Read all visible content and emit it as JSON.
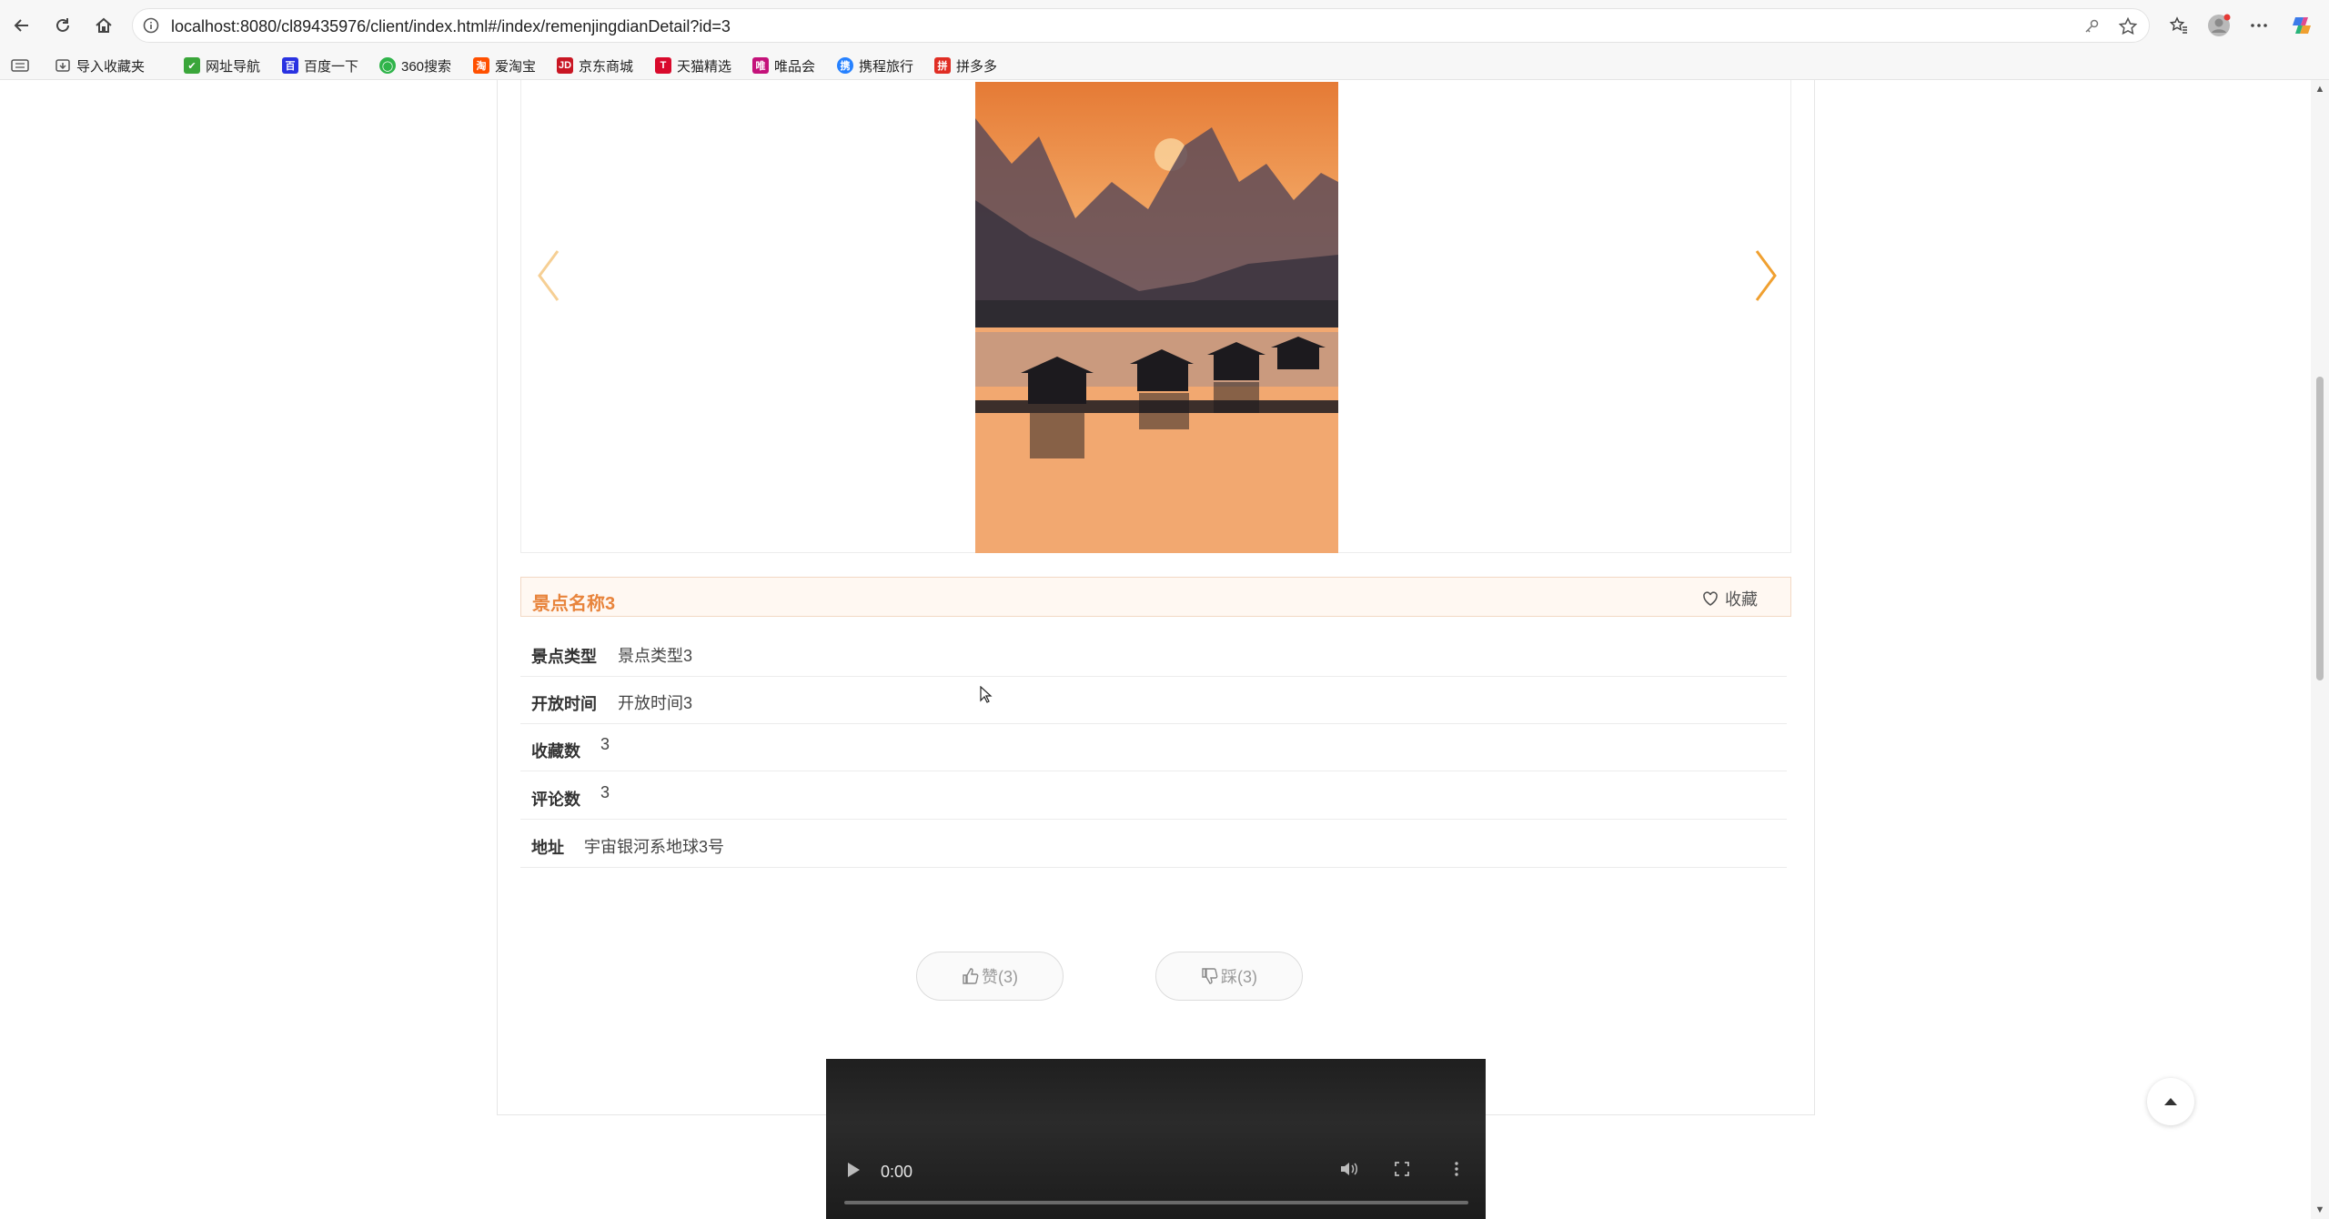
{
  "browser": {
    "url": "localhost:8080/cl89435976/client/index.html#/index/remenjingdianDetail?id=3",
    "bookmarks": [
      {
        "label": "导入收藏夹",
        "icon": "import-icon",
        "color": "#555555"
      },
      {
        "label": "网址导航",
        "icon": "nav-site-icon",
        "color": "#3aa63a"
      },
      {
        "label": "百度一下",
        "icon": "baidu-icon",
        "color": "#2932e1"
      },
      {
        "label": "360搜索",
        "icon": "360-icon",
        "color": "#2fb44a"
      },
      {
        "label": "爱淘宝",
        "icon": "taobao-icon",
        "color": "#ff5000"
      },
      {
        "label": "京东商城",
        "icon": "jd-icon",
        "color": "#c91623"
      },
      {
        "label": "天猫精选",
        "icon": "tmall-icon",
        "color": "#d90a2c"
      },
      {
        "label": "唯品会",
        "icon": "vip-icon",
        "color": "#c4127a"
      },
      {
        "label": "携程旅行",
        "icon": "ctrip-icon",
        "color": "#2681ff"
      },
      {
        "label": "拼多多",
        "icon": "pdd-icon",
        "color": "#e02e24"
      }
    ]
  },
  "detail": {
    "title": "景点名称3",
    "favorite_label": "收藏",
    "fields": [
      {
        "label": "景点类型",
        "value": "景点类型3"
      },
      {
        "label": "开放时间",
        "value": "开放时间3"
      },
      {
        "label": "收藏数",
        "value": "3"
      },
      {
        "label": "评论数",
        "value": "3"
      },
      {
        "label": "地址",
        "value": "宇宙银河系地球3号"
      }
    ],
    "like_label": "赞(3)",
    "dislike_label": "踩(3)"
  },
  "video": {
    "time": "0:00",
    "progress": 0
  },
  "colors": {
    "accent": "#e8843c",
    "arrow": "#f0a030"
  }
}
